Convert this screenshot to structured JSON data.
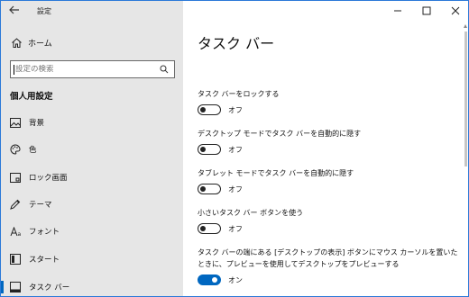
{
  "app": {
    "title": "設定"
  },
  "window_controls": {
    "minimize": "—",
    "maximize": "☐",
    "close": "✕"
  },
  "sidebar": {
    "back_icon": "back-arrow-icon",
    "home_label": "ホーム",
    "search_placeholder": "設定の検索",
    "section_title": "個人用設定",
    "items": [
      {
        "label": "背景",
        "icon": "image-icon"
      },
      {
        "label": "色",
        "icon": "palette-icon"
      },
      {
        "label": "ロック画面",
        "icon": "lock-screen-icon"
      },
      {
        "label": "テーマ",
        "icon": "theme-icon"
      },
      {
        "label": "フォント",
        "icon": "font-icon"
      },
      {
        "label": "スタート",
        "icon": "start-icon"
      },
      {
        "label": "タスク バー",
        "icon": "taskbar-icon",
        "active": true
      }
    ]
  },
  "main": {
    "page_title": "タスク バー",
    "settings": [
      {
        "desc": "タスク バーをロックする",
        "state": "オフ",
        "on": false
      },
      {
        "desc": "デスクトップ モードでタスク バーを自動的に隠す",
        "state": "オフ",
        "on": false
      },
      {
        "desc": "タブレット モードでタスク バーを自動的に隠す",
        "state": "オフ",
        "on": false
      },
      {
        "desc": "小さいタスク バー ボタンを使う",
        "state": "オフ",
        "on": false
      },
      {
        "desc": "タスク バーの端にある [デスクトップの表示] ボタンにマウス カーソルを置いたときに、プレビューを使用してデスクトップをプレビューする",
        "state": "オン",
        "on": true
      }
    ]
  },
  "colors": {
    "accent": "#0067c0",
    "sidebar_bg": "#e6e6e6",
    "window_border": "#2b79d8"
  }
}
